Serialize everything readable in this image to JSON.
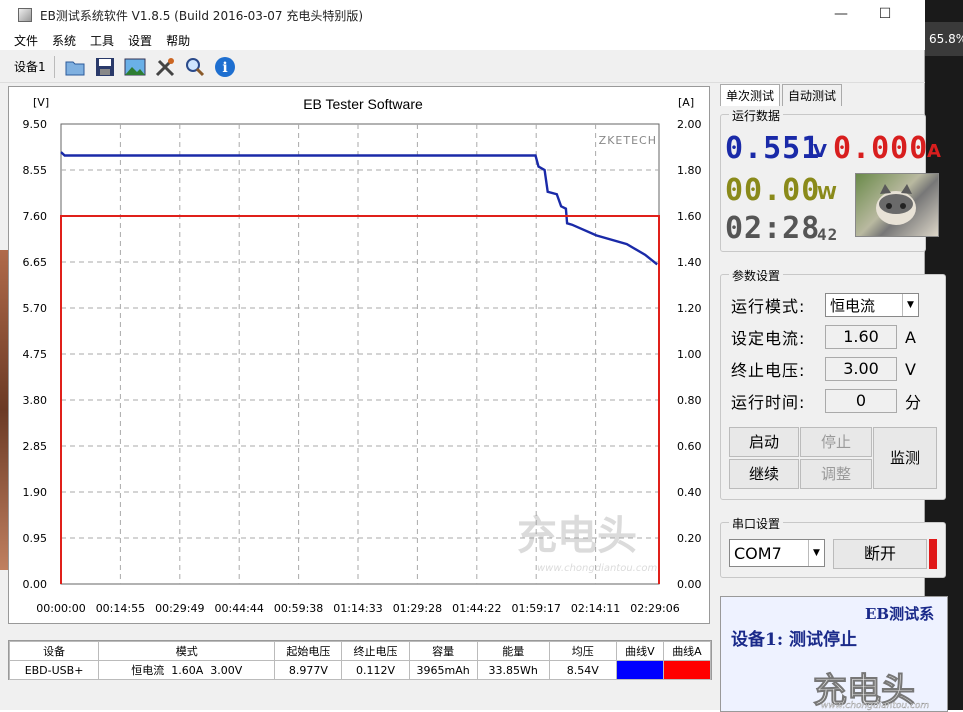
{
  "window": {
    "title": "EB测试系统软件 V1.8.5 (Build 2016-03-07 充电头特别版)",
    "minimize": "—",
    "maximize": "☐"
  },
  "taskbar": {
    "zoom": "65.8%"
  },
  "menu": [
    "文件",
    "系统",
    "工具",
    "设置",
    "帮助"
  ],
  "toolbar": {
    "device": "设备1",
    "icons": [
      "folder-icon",
      "save-icon",
      "image-icon",
      "tools-icon",
      "search-icon",
      "info-icon"
    ]
  },
  "chart_data": {
    "type": "line",
    "title": "EB Tester Software",
    "watermark": "ZKETECH",
    "left_unit": "[V]",
    "right_unit": "[A]",
    "y_left_ticks": [
      "9.50",
      "8.55",
      "7.60",
      "6.65",
      "5.70",
      "4.75",
      "3.80",
      "2.85",
      "1.90",
      "0.95",
      "0.00"
    ],
    "y_right_ticks": [
      "2.00",
      "1.80",
      "1.60",
      "1.40",
      "1.20",
      "1.00",
      "0.80",
      "0.60",
      "0.40",
      "0.20",
      "0.00"
    ],
    "x_ticks": [
      "00:00:00",
      "00:14:55",
      "00:29:49",
      "00:44:44",
      "00:59:38",
      "01:14:33",
      "01:29:28",
      "01:44:22",
      "01:59:17",
      "02:14:11",
      "02:29:06"
    ],
    "ylim_left": [
      0,
      9.5
    ],
    "ylim_right": [
      0,
      2.0
    ],
    "xlim_sec": [
      0,
      8946
    ],
    "series": [
      {
        "name": "曲线V",
        "axis": "left",
        "color": "#1a2aa8",
        "points": [
          [
            0,
            8.92
          ],
          [
            60,
            8.85
          ],
          [
            2000,
            8.85
          ],
          [
            5200,
            8.85
          ],
          [
            6050,
            8.85
          ],
          [
            7800,
            8.85
          ],
          [
            7850,
            8.62
          ],
          [
            7950,
            8.55
          ],
          [
            8000,
            8.1
          ],
          [
            8150,
            8.05
          ],
          [
            8220,
            7.8
          ],
          [
            8300,
            7.75
          ],
          [
            8320,
            7.45
          ],
          [
            8400,
            7.42
          ],
          [
            8800,
            7.2
          ],
          [
            9300,
            7.02
          ],
          [
            9600,
            6.8
          ],
          [
            9800,
            6.6
          ]
        ]
      },
      {
        "name": "曲线A",
        "axis": "right",
        "color": "#e0201a",
        "points": [
          [
            0,
            0.0
          ],
          [
            0,
            1.6
          ],
          [
            9830,
            1.6
          ],
          [
            9830,
            0.0
          ]
        ]
      }
    ],
    "grid": true
  },
  "table": {
    "headers": [
      "设备",
      "模式",
      "起始电压",
      "终止电压",
      "容量",
      "能量",
      "均压",
      "曲线V",
      "曲线A"
    ],
    "row": [
      "EBD-USB+",
      "恒电流  1.60A  3.00V",
      "8.977V",
      "0.112V",
      "3965mAh",
      "33.85Wh",
      "8.54V",
      "",
      ""
    ],
    "colors": {
      "v": "#0000ff",
      "a": "#ff0000"
    }
  },
  "right": {
    "tabs": [
      "单次测试",
      "自动测试"
    ],
    "run_data_label": "运行数据",
    "voltage": "0.551",
    "voltage_unit": "V",
    "current": "0.000",
    "current_unit": "A",
    "power": "00.00",
    "power_unit": "W",
    "time_main": "02:28",
    "time_sec": "42",
    "params_label": "参数设置",
    "mode_label": "运行模式:",
    "mode_value": "恒电流",
    "current_label": "设定电流:",
    "current_value": "1.60",
    "current_set_unit": "A",
    "stopv_label": "终止电压:",
    "stopv_value": "3.00",
    "stopv_unit": "V",
    "time_label": "运行时间:",
    "time_value": "0",
    "time_unit": "分",
    "buttons": {
      "start": "启动",
      "stop": "停止",
      "cont": "继续",
      "adjust": "调整",
      "monitor": "监测"
    },
    "serial_label": "串口设置",
    "com_value": "COM7",
    "disconnect": "断开",
    "status_title": "EB测试系",
    "status_msg": "设备1: 测试停止",
    "watermark": "充电头",
    "watermark_url": "www.chongdiantou.com"
  },
  "colors": {
    "blue_seg": "#1a2aa8",
    "red_seg": "#d81e1e",
    "olive_seg": "#8a8a1a",
    "gray_seg": "#555555"
  }
}
